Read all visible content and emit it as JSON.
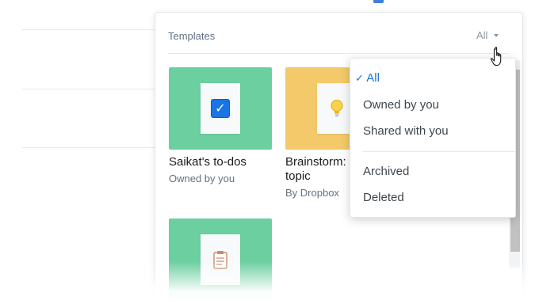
{
  "panel": {
    "title": "Templates",
    "filter_label": "All"
  },
  "templates": [
    {
      "title": "Saikat's to-dos",
      "subtitle": "Owned by you",
      "color": "#6bcfa0",
      "icon": "checkbox-icon"
    },
    {
      "title_line1": "Brainstorm:",
      "title_line2": "topic",
      "subtitle": "By Dropbox",
      "color": "#f3c969",
      "icon": "lightbulb-icon"
    },
    {
      "title": "",
      "subtitle": "",
      "color": "#6bcfa0",
      "icon": "clipboard-icon"
    }
  ],
  "dropdown": {
    "check_mark": "✓",
    "items": [
      {
        "label": "All",
        "selected": true
      },
      {
        "label": "Owned by you"
      },
      {
        "label": "Shared with you"
      },
      {
        "label": "Archived"
      },
      {
        "label": "Deleted"
      }
    ]
  },
  "colors": {
    "accent": "#1b74e4",
    "green_card": "#6bcfa0",
    "yellow_card": "#f3c969"
  }
}
